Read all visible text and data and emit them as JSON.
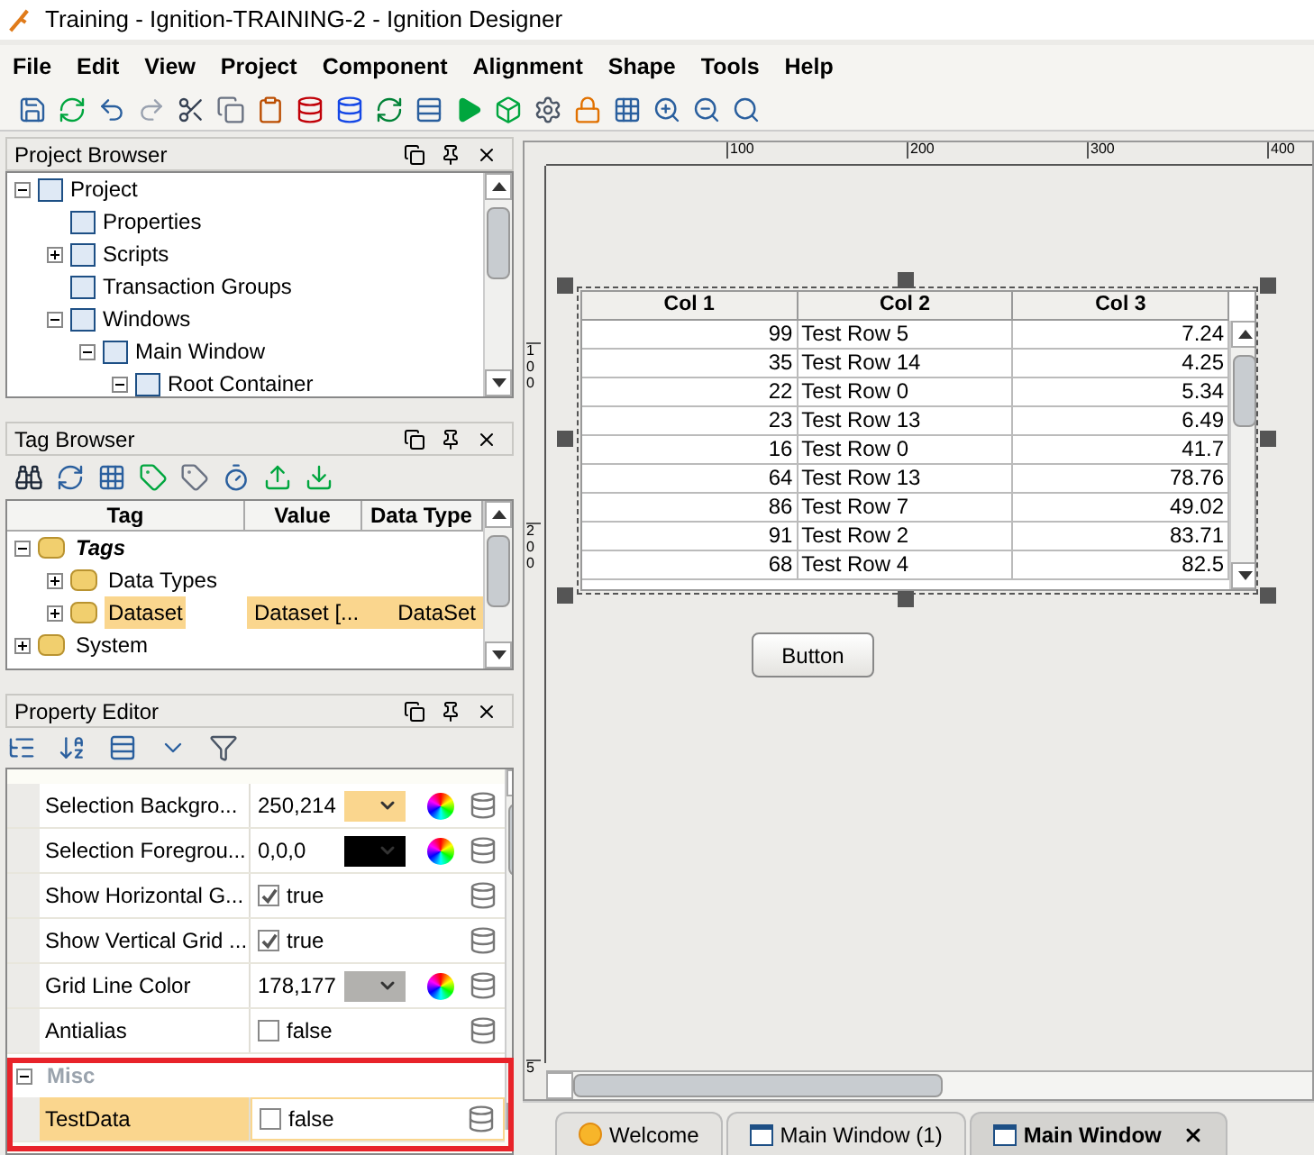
{
  "window": {
    "title": "Training - Ignition-TRAINING-2 - Ignition Designer"
  },
  "menu": [
    {
      "label": "File"
    },
    {
      "label": "Edit"
    },
    {
      "label": "View"
    },
    {
      "label": "Project"
    },
    {
      "label": "Component"
    },
    {
      "label": "Alignment"
    },
    {
      "label": "Shape"
    },
    {
      "label": "Tools"
    },
    {
      "label": "Help"
    }
  ],
  "project_browser": {
    "title": "Project Browser",
    "items": [
      {
        "label": "Project",
        "expanded": true,
        "children": [
          {
            "label": "Properties"
          },
          {
            "label": "Scripts",
            "expanded": false
          },
          {
            "label": "Transaction Groups"
          },
          {
            "label": "Windows",
            "expanded": true,
            "children": [
              {
                "label": "Main Window",
                "expanded": true,
                "children": [
                  {
                    "label": "Root Container",
                    "expanded": true
                  }
                ]
              }
            ]
          }
        ]
      }
    ]
  },
  "tag_browser": {
    "title": "Tag Browser",
    "columns": [
      "Tag",
      "Value",
      "Data Type"
    ],
    "rows": [
      {
        "label": "Tags",
        "expanded": true,
        "selected": false,
        "children": [
          {
            "label": "Data Types",
            "expanded": false,
            "selected": false
          },
          {
            "label": "Dataset",
            "expanded": false,
            "selected": true,
            "value": "Dataset [...",
            "data_type": "DataSet"
          }
        ]
      },
      {
        "label": "System",
        "expanded": false,
        "selected": false
      }
    ]
  },
  "property_editor": {
    "title": "Property Editor",
    "rows": [
      {
        "kind": "color",
        "name": "Selection Backgro...",
        "value": "250,214",
        "color": "#fad68e",
        "selected": false
      },
      {
        "kind": "color",
        "name": "Selection Foregrou...",
        "value": "0,0,0",
        "color": "#000000",
        "selected": false
      },
      {
        "kind": "bool",
        "name": "Show Horizontal G...",
        "value": "true",
        "checked": true,
        "selected": false
      },
      {
        "kind": "bool",
        "name": "Show Vertical Grid ...",
        "value": "true",
        "checked": true,
        "selected": false
      },
      {
        "kind": "color",
        "name": "Grid Line Color",
        "value": "178,177",
        "color": "#b2b1ae",
        "selected": false
      },
      {
        "kind": "bool",
        "name": "Antialias",
        "value": "false",
        "checked": false,
        "selected": false
      },
      {
        "kind": "category",
        "name": "Misc",
        "expanded": true,
        "highlighted": true
      },
      {
        "kind": "bool",
        "name": "TestData",
        "value": "false",
        "checked": false,
        "selected": true,
        "highlighted": true
      }
    ]
  },
  "canvas": {
    "top_ruler": [
      "100",
      "200",
      "300",
      "400"
    ],
    "left_ruler": [
      "100",
      "200",
      "5"
    ],
    "table": {
      "columns": [
        "Col 1",
        "Col 2",
        "Col 3"
      ],
      "rows": [
        [
          "99",
          "Test Row 5",
          "7.24"
        ],
        [
          "35",
          "Test Row 14",
          "4.25"
        ],
        [
          "22",
          "Test Row 0",
          "5.34"
        ],
        [
          "23",
          "Test Row 13",
          "6.49"
        ],
        [
          "16",
          "Test Row 0",
          "41.7"
        ],
        [
          "64",
          "Test Row 13",
          "78.76"
        ],
        [
          "86",
          "Test Row 7",
          "49.02"
        ],
        [
          "91",
          "Test Row 2",
          "83.71"
        ],
        [
          "68",
          "Test Row 4",
          "82.5"
        ]
      ]
    },
    "button": {
      "label": "Button"
    }
  },
  "tabs": [
    {
      "label": "Welcome",
      "kind": "welcome",
      "selected": false,
      "closable": false
    },
    {
      "label": "Main Window (1)",
      "kind": "window",
      "selected": false,
      "closable": false
    },
    {
      "label": "Main Window",
      "kind": "window",
      "selected": true,
      "closable": true
    }
  ]
}
